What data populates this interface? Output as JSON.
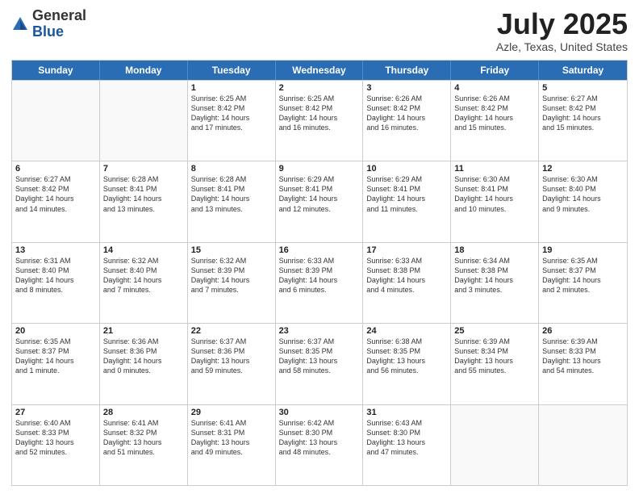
{
  "header": {
    "logo_general": "General",
    "logo_blue": "Blue",
    "month_title": "July 2025",
    "location": "Azle, Texas, United States"
  },
  "calendar": {
    "days_of_week": [
      "Sunday",
      "Monday",
      "Tuesday",
      "Wednesday",
      "Thursday",
      "Friday",
      "Saturday"
    ],
    "rows": [
      [
        {
          "day": "",
          "lines": [],
          "empty": true
        },
        {
          "day": "",
          "lines": [],
          "empty": true
        },
        {
          "day": "1",
          "lines": [
            "Sunrise: 6:25 AM",
            "Sunset: 8:42 PM",
            "Daylight: 14 hours",
            "and 17 minutes."
          ],
          "empty": false
        },
        {
          "day": "2",
          "lines": [
            "Sunrise: 6:25 AM",
            "Sunset: 8:42 PM",
            "Daylight: 14 hours",
            "and 16 minutes."
          ],
          "empty": false
        },
        {
          "day": "3",
          "lines": [
            "Sunrise: 6:26 AM",
            "Sunset: 8:42 PM",
            "Daylight: 14 hours",
            "and 16 minutes."
          ],
          "empty": false
        },
        {
          "day": "4",
          "lines": [
            "Sunrise: 6:26 AM",
            "Sunset: 8:42 PM",
            "Daylight: 14 hours",
            "and 15 minutes."
          ],
          "empty": false
        },
        {
          "day": "5",
          "lines": [
            "Sunrise: 6:27 AM",
            "Sunset: 8:42 PM",
            "Daylight: 14 hours",
            "and 15 minutes."
          ],
          "empty": false
        }
      ],
      [
        {
          "day": "6",
          "lines": [
            "Sunrise: 6:27 AM",
            "Sunset: 8:42 PM",
            "Daylight: 14 hours",
            "and 14 minutes."
          ],
          "empty": false
        },
        {
          "day": "7",
          "lines": [
            "Sunrise: 6:28 AM",
            "Sunset: 8:41 PM",
            "Daylight: 14 hours",
            "and 13 minutes."
          ],
          "empty": false
        },
        {
          "day": "8",
          "lines": [
            "Sunrise: 6:28 AM",
            "Sunset: 8:41 PM",
            "Daylight: 14 hours",
            "and 13 minutes."
          ],
          "empty": false
        },
        {
          "day": "9",
          "lines": [
            "Sunrise: 6:29 AM",
            "Sunset: 8:41 PM",
            "Daylight: 14 hours",
            "and 12 minutes."
          ],
          "empty": false
        },
        {
          "day": "10",
          "lines": [
            "Sunrise: 6:29 AM",
            "Sunset: 8:41 PM",
            "Daylight: 14 hours",
            "and 11 minutes."
          ],
          "empty": false
        },
        {
          "day": "11",
          "lines": [
            "Sunrise: 6:30 AM",
            "Sunset: 8:41 PM",
            "Daylight: 14 hours",
            "and 10 minutes."
          ],
          "empty": false
        },
        {
          "day": "12",
          "lines": [
            "Sunrise: 6:30 AM",
            "Sunset: 8:40 PM",
            "Daylight: 14 hours",
            "and 9 minutes."
          ],
          "empty": false
        }
      ],
      [
        {
          "day": "13",
          "lines": [
            "Sunrise: 6:31 AM",
            "Sunset: 8:40 PM",
            "Daylight: 14 hours",
            "and 8 minutes."
          ],
          "empty": false
        },
        {
          "day": "14",
          "lines": [
            "Sunrise: 6:32 AM",
            "Sunset: 8:40 PM",
            "Daylight: 14 hours",
            "and 7 minutes."
          ],
          "empty": false
        },
        {
          "day": "15",
          "lines": [
            "Sunrise: 6:32 AM",
            "Sunset: 8:39 PM",
            "Daylight: 14 hours",
            "and 7 minutes."
          ],
          "empty": false
        },
        {
          "day": "16",
          "lines": [
            "Sunrise: 6:33 AM",
            "Sunset: 8:39 PM",
            "Daylight: 14 hours",
            "and 6 minutes."
          ],
          "empty": false
        },
        {
          "day": "17",
          "lines": [
            "Sunrise: 6:33 AM",
            "Sunset: 8:38 PM",
            "Daylight: 14 hours",
            "and 4 minutes."
          ],
          "empty": false
        },
        {
          "day": "18",
          "lines": [
            "Sunrise: 6:34 AM",
            "Sunset: 8:38 PM",
            "Daylight: 14 hours",
            "and 3 minutes."
          ],
          "empty": false
        },
        {
          "day": "19",
          "lines": [
            "Sunrise: 6:35 AM",
            "Sunset: 8:37 PM",
            "Daylight: 14 hours",
            "and 2 minutes."
          ],
          "empty": false
        }
      ],
      [
        {
          "day": "20",
          "lines": [
            "Sunrise: 6:35 AM",
            "Sunset: 8:37 PM",
            "Daylight: 14 hours",
            "and 1 minute."
          ],
          "empty": false
        },
        {
          "day": "21",
          "lines": [
            "Sunrise: 6:36 AM",
            "Sunset: 8:36 PM",
            "Daylight: 14 hours",
            "and 0 minutes."
          ],
          "empty": false
        },
        {
          "day": "22",
          "lines": [
            "Sunrise: 6:37 AM",
            "Sunset: 8:36 PM",
            "Daylight: 13 hours",
            "and 59 minutes."
          ],
          "empty": false
        },
        {
          "day": "23",
          "lines": [
            "Sunrise: 6:37 AM",
            "Sunset: 8:35 PM",
            "Daylight: 13 hours",
            "and 58 minutes."
          ],
          "empty": false
        },
        {
          "day": "24",
          "lines": [
            "Sunrise: 6:38 AM",
            "Sunset: 8:35 PM",
            "Daylight: 13 hours",
            "and 56 minutes."
          ],
          "empty": false
        },
        {
          "day": "25",
          "lines": [
            "Sunrise: 6:39 AM",
            "Sunset: 8:34 PM",
            "Daylight: 13 hours",
            "and 55 minutes."
          ],
          "empty": false
        },
        {
          "day": "26",
          "lines": [
            "Sunrise: 6:39 AM",
            "Sunset: 8:33 PM",
            "Daylight: 13 hours",
            "and 54 minutes."
          ],
          "empty": false
        }
      ],
      [
        {
          "day": "27",
          "lines": [
            "Sunrise: 6:40 AM",
            "Sunset: 8:33 PM",
            "Daylight: 13 hours",
            "and 52 minutes."
          ],
          "empty": false
        },
        {
          "day": "28",
          "lines": [
            "Sunrise: 6:41 AM",
            "Sunset: 8:32 PM",
            "Daylight: 13 hours",
            "and 51 minutes."
          ],
          "empty": false
        },
        {
          "day": "29",
          "lines": [
            "Sunrise: 6:41 AM",
            "Sunset: 8:31 PM",
            "Daylight: 13 hours",
            "and 49 minutes."
          ],
          "empty": false
        },
        {
          "day": "30",
          "lines": [
            "Sunrise: 6:42 AM",
            "Sunset: 8:30 PM",
            "Daylight: 13 hours",
            "and 48 minutes."
          ],
          "empty": false
        },
        {
          "day": "31",
          "lines": [
            "Sunrise: 6:43 AM",
            "Sunset: 8:30 PM",
            "Daylight: 13 hours",
            "and 47 minutes."
          ],
          "empty": false
        },
        {
          "day": "",
          "lines": [],
          "empty": true
        },
        {
          "day": "",
          "lines": [],
          "empty": true
        }
      ]
    ]
  }
}
